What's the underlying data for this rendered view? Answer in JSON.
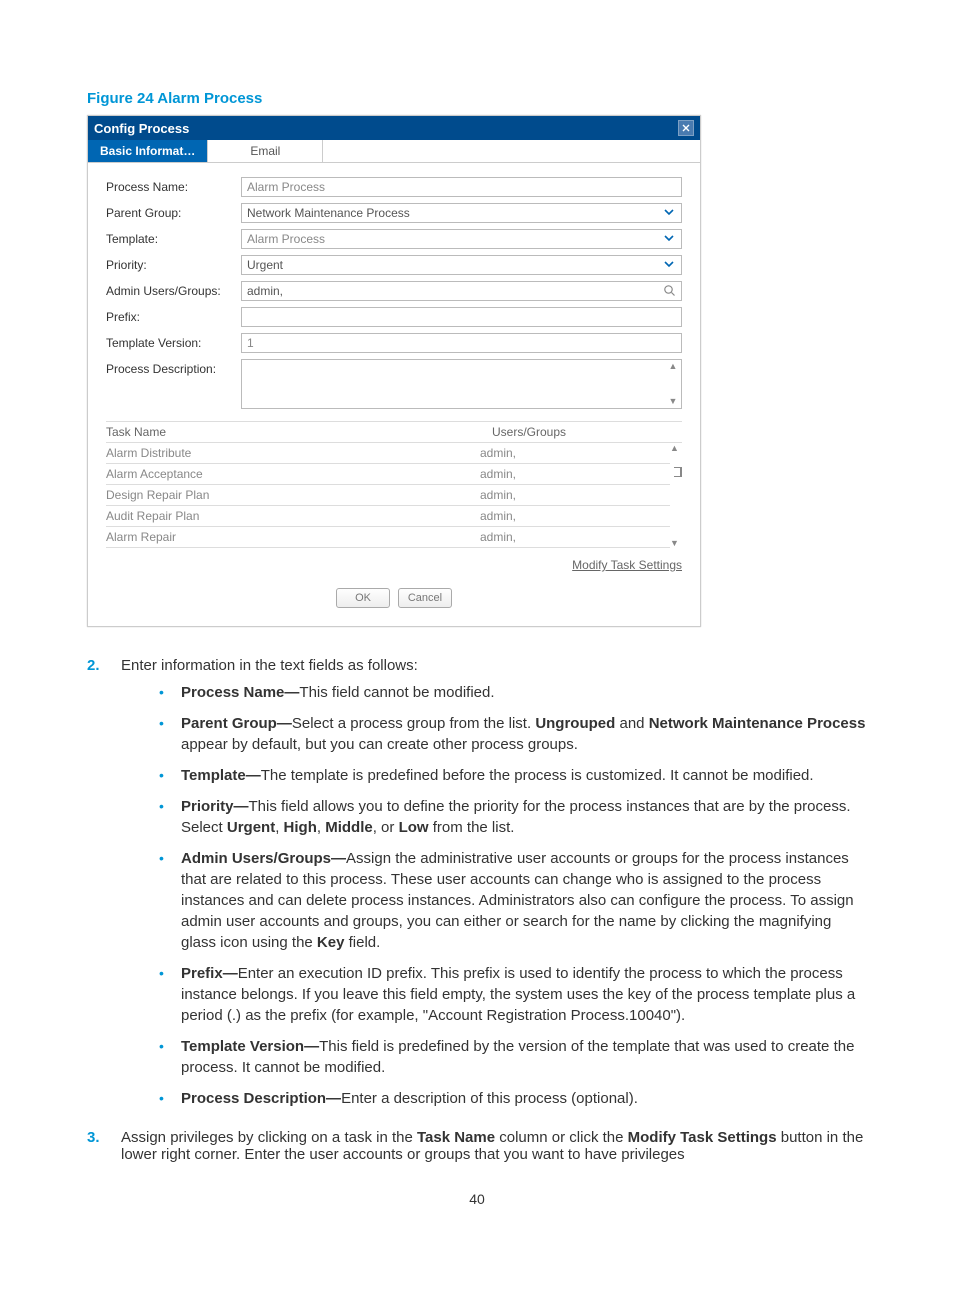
{
  "figure_caption": "Figure 24 Alarm Process",
  "dialog": {
    "title": "Config Process",
    "tabs": {
      "active": "Basic Informat…",
      "email": "Email"
    },
    "fields": {
      "process_name": {
        "label": "Process Name:",
        "value": "Alarm Process"
      },
      "parent_group": {
        "label": "Parent Group:",
        "value": "Network Maintenance Process"
      },
      "template": {
        "label": "Template:",
        "value": "Alarm Process"
      },
      "priority": {
        "label": "Priority:",
        "value": "Urgent"
      },
      "admin": {
        "label": "Admin Users/Groups:",
        "value": "admin,"
      },
      "prefix": {
        "label": "Prefix:",
        "value": ""
      },
      "tversion": {
        "label": "Template Version:",
        "value": "1"
      },
      "pdesc": {
        "label": "Process Description:",
        "value": ""
      }
    },
    "table": {
      "head": {
        "c1": "Task Name",
        "c2": "Users/Groups"
      },
      "rows": [
        {
          "c1": "Alarm Distribute",
          "c2": "admin,"
        },
        {
          "c1": "Alarm Acceptance",
          "c2": "admin,"
        },
        {
          "c1": "Design Repair Plan",
          "c2": "admin,"
        },
        {
          "c1": "Audit Repair Plan",
          "c2": "admin,"
        },
        {
          "c1": "Alarm Repair",
          "c2": "admin,"
        }
      ]
    },
    "modify_link": "Modify Task Settings",
    "buttons": {
      "ok": "OK",
      "cancel": "Cancel"
    }
  },
  "body": {
    "step2_intro": "Enter information in the text fields as follows:",
    "pn": {
      "t": "Process Name—",
      "d": "This field cannot be modified."
    },
    "pg": {
      "t": "Parent Group—",
      "d1": "Select a process group from the list. ",
      "u": "Ungrouped",
      "and": " and ",
      "nmp": "Network Maintenance Process",
      "d2": " appear by default, but you can create other process groups."
    },
    "tp": {
      "t": "Template—",
      "d": "The template is predefined before the process is customized. It cannot be modified."
    },
    "pr": {
      "t": "Priority—",
      "d1": "This field allows you to define the priority for the process instances that are by the process. Select ",
      "u": "Urgent",
      "c1": ", ",
      "h": "High",
      "c2": ", ",
      "m": "Middle",
      "c3": ", or ",
      "l": "Low",
      "d2": " from the list."
    },
    "aug": {
      "t": "Admin Users/Groups—",
      "d1": "Assign the administrative user accounts or groups for the process instances that are related to this process. These user accounts can change who is assigned to the process instances and can delete process instances. Administrators also can configure the process. To assign admin user accounts and groups, you can either or search for the name by clicking the magnifying glass icon using the ",
      "k": "Key",
      "d2": " field."
    },
    "pf": {
      "t": "Prefix—",
      "d": "Enter an execution ID prefix. This prefix is used to identify the process to which the process instance belongs. If you leave this field empty, the system uses the key of the process template plus a period (.) as the prefix (for example, \"Account Registration Process.10040\")."
    },
    "tv": {
      "t": "Template Version—",
      "d": "This field is predefined by the version of the template that was used to create the process. It cannot be modified."
    },
    "pd": {
      "t": "Process Description—",
      "d": "Enter a description of this process (optional)."
    },
    "step3": {
      "d1": "Assign privileges by clicking on a task in the ",
      "tn": "Task Name",
      "d2": " column or click the ",
      "mts": "Modify Task Settings",
      "d3": " button in the lower right corner. Enter the user accounts or groups that you want to have privileges"
    }
  },
  "page_number": "40"
}
